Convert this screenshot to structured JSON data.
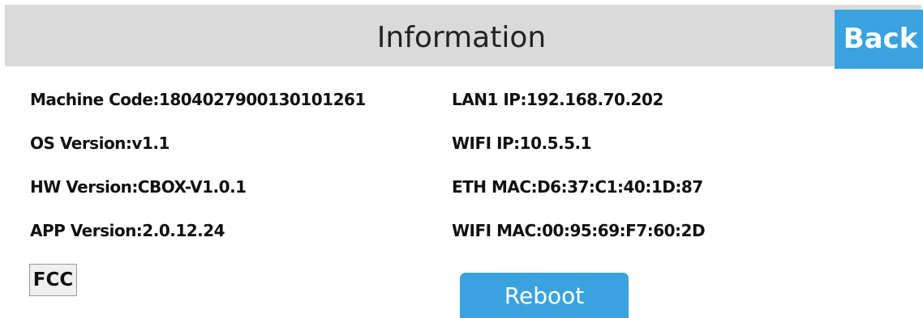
{
  "header": {
    "title": "Information",
    "back_label": "Back"
  },
  "info_left": [
    {
      "text": "Machine Code:1804027900130101261"
    },
    {
      "text": "OS Version:v1.1"
    },
    {
      "text": "HW Version:CBOX-V1.0.1"
    },
    {
      "text": "APP Version:2.0.12.24"
    }
  ],
  "info_right": [
    {
      "text": "LAN1 IP:192.168.70.202"
    },
    {
      "text": "WIFI IP:10.5.5.1"
    },
    {
      "text": "ETH MAC:D6:37:C1:40:1D:87"
    },
    {
      "text": "WIFI MAC:00:95:69:F7:60:2D"
    }
  ],
  "buttons": {
    "fcc_label": "FCC",
    "reboot_label": "Reboot"
  },
  "colors": {
    "accent": "#3aa3df",
    "header_bg": "#dadada"
  }
}
